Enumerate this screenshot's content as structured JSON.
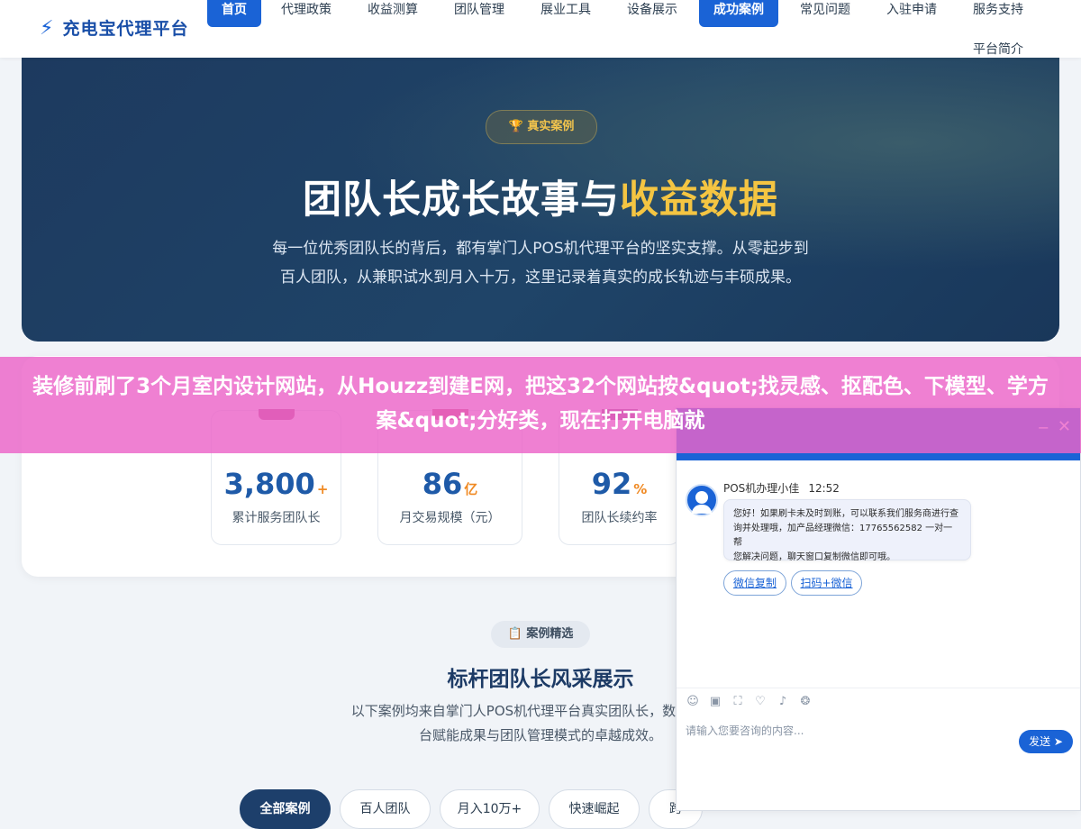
{
  "header": {
    "logo_icon": "bolt-icon",
    "brand": "充电宝代理平台",
    "nav": [
      "首页",
      "代理政策",
      "收益测算",
      "团队管理",
      "展业工具",
      "设备展示",
      "成功案例",
      "常见问题",
      "入驻申请",
      "服务支持"
    ],
    "nav_second_row": "平台简介",
    "active_items": [
      "首页",
      "成功案例"
    ]
  },
  "hero": {
    "badge": "🏆 真实案例",
    "title_part1": "团队长成长故事与",
    "title_highlight": "收益数据",
    "desc_line1": "每一位优秀团队长的背后，都有掌门人POS机代理平台的坚实支撑。从零起步到",
    "desc_line2": "百人团队，从兼职试水到月入十万，这里记录着真实的成长轨迹与丰硕成果。"
  },
  "stats": [
    {
      "value": "3,800",
      "unit": "+",
      "label": "累计服务团队长"
    },
    {
      "value": "86",
      "unit": "亿",
      "label": "月交易规模（元）"
    },
    {
      "value": "92",
      "unit": "%",
      "label": "团队长续约率"
    }
  ],
  "cases": {
    "badge": "📋 案例精选",
    "title": "标杆团队长风采展示",
    "desc_line1": "以下案例均来自掌门人POS机代理平台真实团队长，数据经本人",
    "desc_line2": "台赋能成果与团队管理模式的卓越成效。",
    "filters": [
      "全部案例",
      "百人团队",
      "月入10万+",
      "快速崛起",
      "跨"
    ]
  },
  "banner": {
    "text": "装修前刷了3个月室内设计网站，从Houzz到建E网，把这32个网站按&quot;找灵感、抠配色、下模型、学方案&quot;分好类，现在打开电脑就"
  },
  "chat": {
    "minimize": "−",
    "close": "✕",
    "sender": "POS机办理小佳",
    "time": "12:52",
    "message_line1": "您好！如果刷卡未及时到账，可以联系我们服务商进行查",
    "message_line2": "询并处理哦，加产品经理微信：17765562582 一对一帮",
    "message_line3": "您解决问题，聊天窗口复制微信即可哦。",
    "buttons": [
      "微信复制",
      "扫码+微信"
    ],
    "tools": [
      "☺",
      "▣",
      "⛶",
      "♡",
      "♪",
      "❂"
    ],
    "input_placeholder": "请输入您要咨询的内容...",
    "send": "发送 ➤"
  },
  "colors": {
    "primary": "#1a63d6",
    "hero_bg": "#1d3a5f",
    "highlight": "#f4c542",
    "banner": "#ec64c8"
  }
}
